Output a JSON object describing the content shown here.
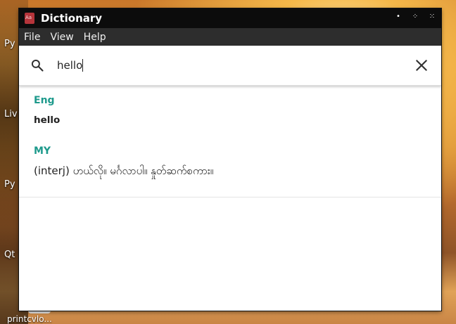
{
  "window": {
    "title": "Dictionary"
  },
  "menu": [
    "File",
    "View",
    "Help"
  ],
  "search": {
    "value": "hello"
  },
  "results": {
    "source_lang": "Eng",
    "word": "hello",
    "target_lang": "MY",
    "definition": "(interj) ဟယ်လို။ မင်္ဂလာပါ။ နှုတ်ဆက်စကား။"
  },
  "desktop": {
    "labels": [
      "Py",
      "Liv",
      "Py",
      "Qt"
    ],
    "bottom_text": "printcvlo..."
  },
  "icons": {
    "app": "dictionary-app-icon",
    "search": "search-icon",
    "clear": "close-icon"
  },
  "colors": {
    "accent": "#1e9a8c",
    "titlebar": "#0c0c0c",
    "menubar": "#2d2d2d"
  }
}
